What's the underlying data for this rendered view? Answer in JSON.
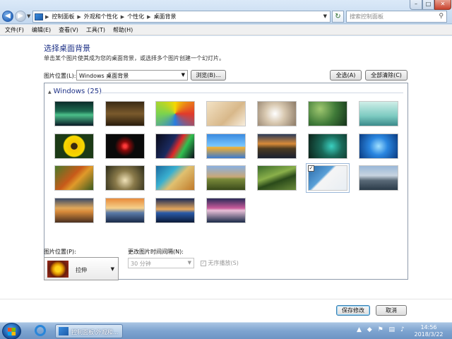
{
  "address": {
    "crumbs": [
      "控制面板",
      "外观和个性化",
      "个性化",
      "桌面背景"
    ],
    "search_placeholder": "搜索控制面板"
  },
  "menu": [
    "文件(F)",
    "编辑(E)",
    "查看(V)",
    "工具(T)",
    "帮助(H)"
  ],
  "page": {
    "title": "选择桌面背景",
    "subtitle": "单击某个图片使其成为您的桌面背景，或选择多个图片创建一个幻灯片。",
    "location_label": "图片位置(L):",
    "location_value": "Windows 桌面背景",
    "browse": "浏览(B)...",
    "select_all": "全选(A)",
    "clear_all": "全部清除(C)"
  },
  "gallery": {
    "group": "Windows (25)",
    "thumbs": [
      {
        "name": "aurora",
        "bg": "linear-gradient(#0b2b2a,#1c6a4f 40%,#4bc08a 55%,#0a1a26)",
        "checked": false
      },
      {
        "name": "grass",
        "bg": "linear-gradient(#3a2a14,#7a5a2c 50%,#2a1c0c)",
        "checked": false
      },
      {
        "name": "balloon",
        "bg": "conic-gradient(#f5d800,#e23a2a,#2a7ce0,#7bd34e,#f5d800)",
        "checked": false
      },
      {
        "name": "paper",
        "bg": "linear-gradient(135deg,#f3e2c4,#d8b88a 60%,#f8eedd)",
        "checked": false
      },
      {
        "name": "dandelion",
        "bg": "radial-gradient(circle at 45% 50%,#ffffff,#d8c8b0 40%,#8c7a66)",
        "checked": false
      },
      {
        "name": "droplet",
        "bg": "radial-gradient(circle at 30% 30%,#a0c870,#3f7a38 50%,#14321a)",
        "checked": false
      },
      {
        "name": "blue-bottles",
        "bg": "linear-gradient(#cfeee8,#7ccac0 60%,#3a8a8a)",
        "checked": false
      },
      {
        "name": "sunflower",
        "bg": "radial-gradient(circle,#3a2a10 14%,#f5c500 16%,#f7d900 45%,#1c3a16 50%)",
        "checked": false
      },
      {
        "name": "red-star",
        "bg": "radial-gradient(circle,#ff3a3a 6%,#8a0a0a 20%,#0a0a0a 45%)",
        "checked": false
      },
      {
        "name": "wave",
        "bg": "linear-gradient(120deg,#0a0a18,#1a2a60 40%,#e02a2a 55%,#30c050 70%,#0a0a18)",
        "checked": false
      },
      {
        "name": "fish",
        "bg": "linear-gradient(#3a8ae0,#7ac8ff 50%,#f5b030 55%,#3a7ad0)",
        "checked": false
      },
      {
        "name": "sunset-lake",
        "bg": "linear-gradient(#2a3a58,#d88a38 40%,#4a3a20 60%,#1a2030)",
        "checked": false
      },
      {
        "name": "bird",
        "bg": "radial-gradient(circle at 60% 50%,#3ad0c0,#1a6a5a 40%,#0c2218)",
        "checked": false
      },
      {
        "name": "win7-logo",
        "bg": "radial-gradient(circle at 50% 50%,#a0e0ff,#2a86e0 40%,#0a3a80)",
        "checked": false
      },
      {
        "name": "leaves",
        "bg": "linear-gradient(135deg,#4a7a2a,#c85a1a 45%,#e09a2a 60%,#3a5a20)",
        "checked": false
      },
      {
        "name": "mushroom",
        "bg": "radial-gradient(circle at 50% 60%,#f0e2b8,#8a7a4a 40%,#2a2a18)",
        "checked": false
      },
      {
        "name": "coast",
        "bg": "linear-gradient(135deg,#1a6aa0,#3ab0d0 35%,#e0c070 55%,#c07a2a)",
        "checked": false
      },
      {
        "name": "field",
        "bg": "linear-gradient(#8ab0e0,#c8a878 45%,#7a8a3a 55%,#3a4a1a)",
        "checked": false
      },
      {
        "name": "rice-terrace",
        "bg": "linear-gradient(160deg,#3a6a2a,#8ab04a 40%,#2a4a1a 60%,#6a8a3a)",
        "checked": false
      },
      {
        "name": "architecture",
        "bg": "linear-gradient(135deg,#2a6aa8,#5aa0d8 40%,#f5f5f5 45%,#e8eef4)",
        "checked": true
      },
      {
        "name": "sea-cliff",
        "bg": "linear-gradient(#9ab8d8,#c8d4e0 40%,#5a6a78 60%,#2a3a48)",
        "checked": false
      },
      {
        "name": "canyon",
        "bg": "linear-gradient(#3a4a68,#e0a85a 40%,#d88a3a 55%,#4a3020)",
        "checked": false
      },
      {
        "name": "clouds-sunset",
        "bg": "linear-gradient(#e88a3a,#f5d08a 40%,#5a7aa8 60%,#1a2a48)",
        "checked": false
      },
      {
        "name": "blue-horizon",
        "bg": "linear-gradient(#1a2a58,#e8a85a 45%,#2a5aa8 60%,#0a1a38)",
        "checked": false
      },
      {
        "name": "dusk-lake",
        "bg": "linear-gradient(#2a2a58,#c85a9a 40%,#e8c0d8 50%,#1a2a48)",
        "checked": false
      }
    ]
  },
  "bottom": {
    "pos_label": "图片位置(P):",
    "pos_value": "拉伸",
    "interval_label": "更改图片时间间隔(N):",
    "interval_value": "30 分钟",
    "shuffle_label": "无序播放(S)",
    "save": "保存修改",
    "cancel": "取消"
  },
  "taskbar": {
    "task_label": "控制面板\\外观和...",
    "time": "14:56",
    "date": "2018/3/22"
  }
}
